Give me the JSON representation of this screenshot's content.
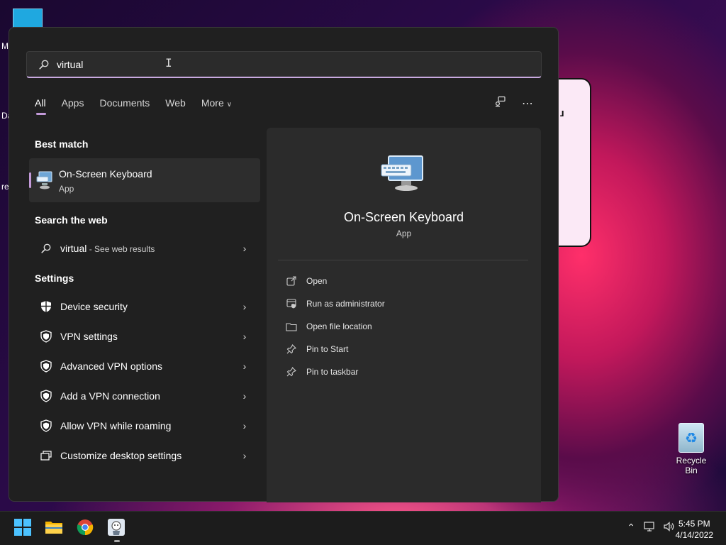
{
  "desktop": {
    "edge_labels": [
      "M",
      "Da",
      "re"
    ],
    "recycle_bin_label": "Recycle Bin"
  },
  "search": {
    "query": "virtual"
  },
  "tabs": [
    {
      "label": "All",
      "active": true
    },
    {
      "label": "Apps"
    },
    {
      "label": "Documents"
    },
    {
      "label": "Web"
    },
    {
      "label": "More"
    }
  ],
  "best_match": {
    "heading": "Best match",
    "title": "On-Screen Keyboard",
    "subtitle": "App"
  },
  "web": {
    "heading": "Search the web",
    "query": "virtual",
    "suffix": " - See web results"
  },
  "settings": {
    "heading": "Settings",
    "items": [
      {
        "label": "Device security",
        "icon": "shield-filled-icon"
      },
      {
        "label": "VPN settings",
        "icon": "shield-icon"
      },
      {
        "label": "Advanced VPN options",
        "icon": "shield-icon"
      },
      {
        "label": "Add a VPN connection",
        "icon": "shield-icon"
      },
      {
        "label": "Allow VPN while roaming",
        "icon": "shield-icon"
      },
      {
        "label": "Customize desktop settings",
        "icon": "windows-icon"
      }
    ]
  },
  "preview": {
    "title": "On-Screen Keyboard",
    "subtitle": "App",
    "actions": [
      {
        "label": "Open",
        "icon": "open-icon"
      },
      {
        "label": "Run as administrator",
        "icon": "admin-icon"
      },
      {
        "label": "Open file location",
        "icon": "folder-icon"
      },
      {
        "label": "Pin to Start",
        "icon": "pin-icon"
      },
      {
        "label": "Pin to taskbar",
        "icon": "pin-icon"
      }
    ]
  },
  "taskbar": {
    "time": "5:45 PM",
    "date": "4/14/2022"
  },
  "colors": {
    "accent": "#c39ad9",
    "panel": "#202020",
    "pane": "#2b2b2b"
  }
}
